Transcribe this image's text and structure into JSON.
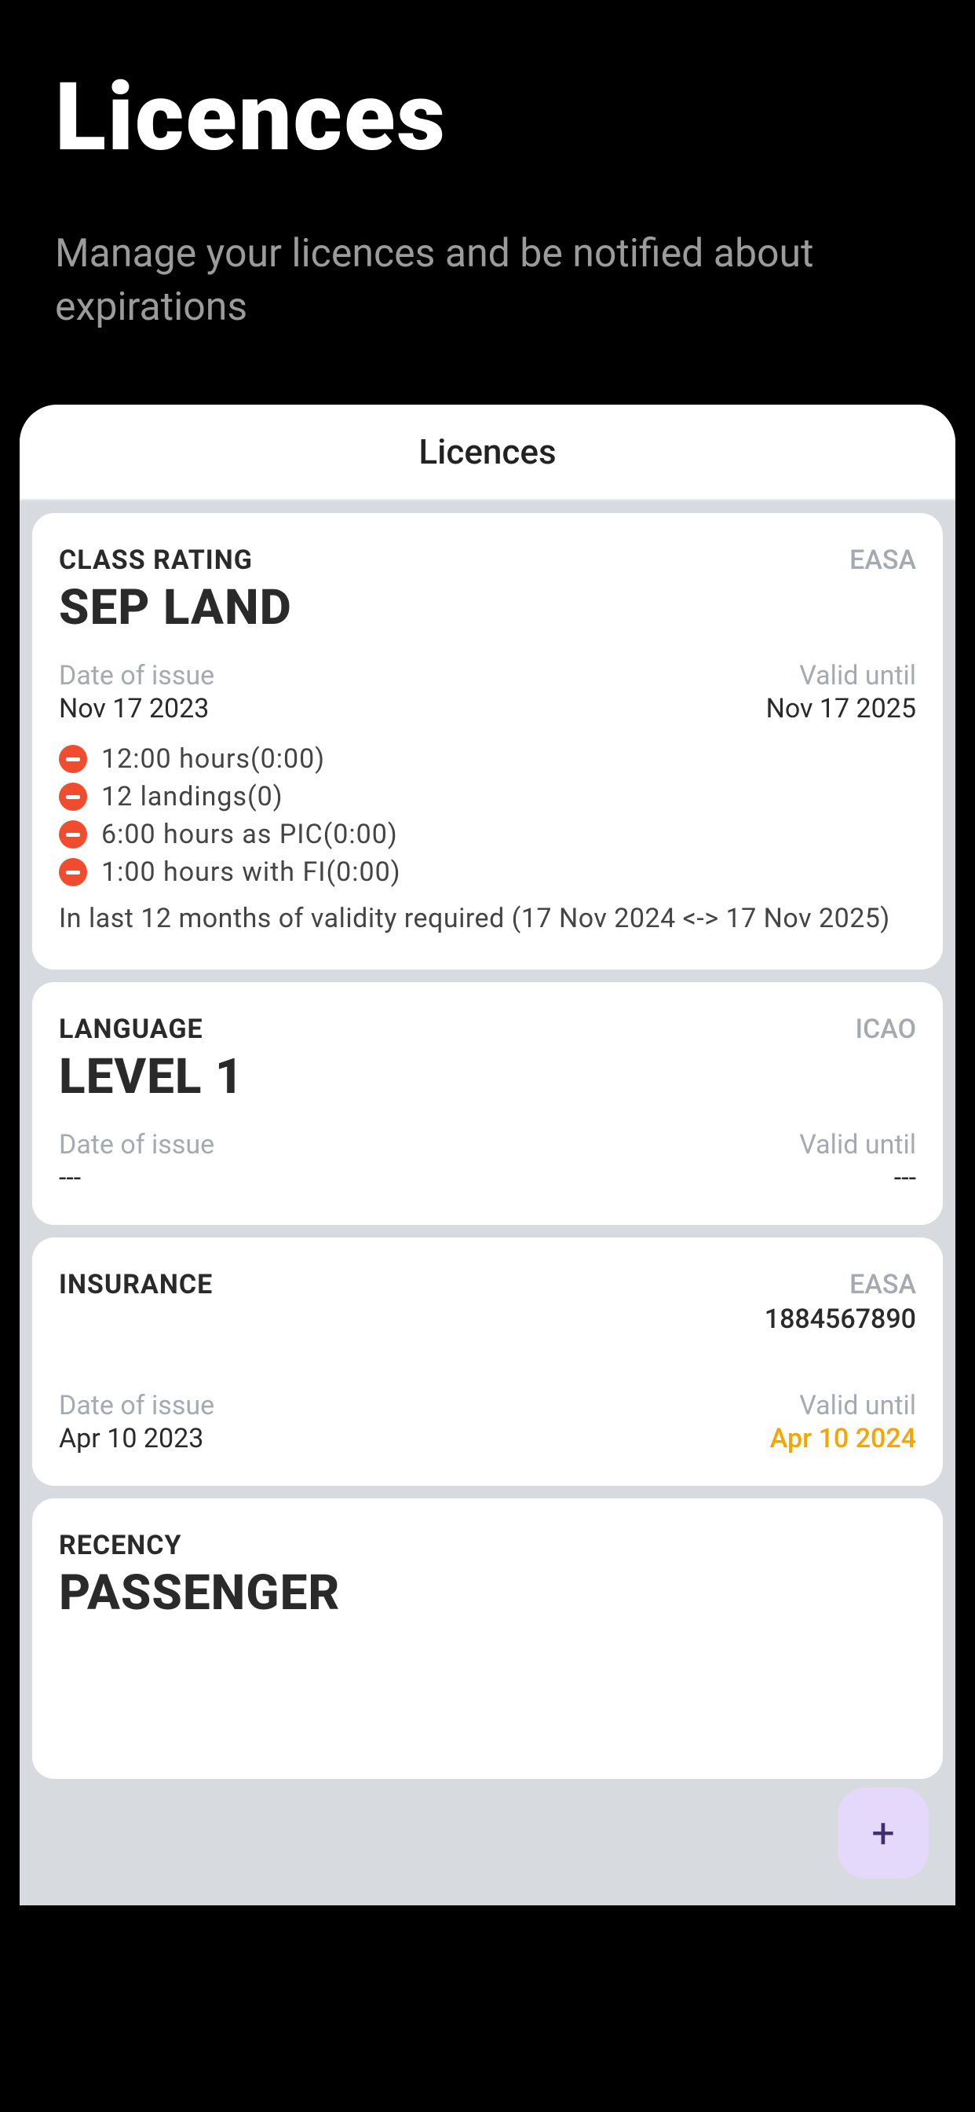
{
  "hero": {
    "title": "Licences",
    "subtitle": "Manage your licences and be notified about expirations"
  },
  "panel": {
    "header": "Licences"
  },
  "labels": {
    "date_of_issue": "Date of issue",
    "valid_until": "Valid until"
  },
  "cards": [
    {
      "category": "CLASS RATING",
      "authority": "EASA",
      "title": "SEP LAND",
      "issue": "Nov 17 2023",
      "valid": "Nov 17 2025",
      "valid_warn": false,
      "requirements": [
        "12:00 hours(0:00)",
        "12 landings(0)",
        "6:00 hours as PIC(0:00)",
        "1:00 hours with FI(0:00)"
      ],
      "note": " In last 12 months of validity required (17 Nov 2024 <-> 17 Nov 2025)"
    },
    {
      "category": "LANGUAGE",
      "authority": "ICAO",
      "title": "LEVEL 1",
      "issue": "---",
      "valid": "---",
      "valid_warn": false
    },
    {
      "category": "INSURANCE",
      "authority": "EASA",
      "authority_number": "1884567890",
      "title": "",
      "issue": "Apr 10 2023",
      "valid": "Apr 10 2024",
      "valid_warn": true
    },
    {
      "category": "RECENCY",
      "title": "PASSENGER"
    }
  ],
  "fab": {
    "glyph": "+"
  }
}
